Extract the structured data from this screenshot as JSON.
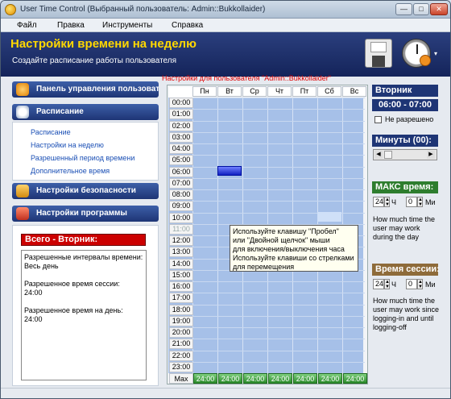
{
  "window": {
    "title": "User Time Control (Выбранный пользователь: Admin::Bukkollaider)"
  },
  "menu": [
    "Файл",
    "Правка",
    "Инструменты",
    "Справка"
  ],
  "header": {
    "title": "Настройки времени на неделю",
    "subtitle": "Создайте расписание работы пользователя"
  },
  "sidebar": {
    "users_panel": "Панель управления пользователями",
    "schedule_panel": "Расписание",
    "schedule_links": [
      "Расписание",
      "Настройки на неделю",
      "Разрешенный период времени",
      "Дополнительное время"
    ],
    "security_panel": "Настройки безопасности",
    "program_panel": "Настройки программы"
  },
  "summary": {
    "title": "Всего - Вторник:",
    "lines": [
      "Разрешенные интервалы времени:",
      "Весь день",
      "",
      "Разрешенное время сессии:",
      "24:00",
      "",
      "Разрешенное время на день:",
      "24:00"
    ]
  },
  "grid": {
    "caption": "Настройки для пользователя \"Admin::Bukkollaider\"",
    "days": [
      "Пн",
      "Вт",
      "Ср",
      "Чт",
      "Пт",
      "Сб",
      "Вс"
    ],
    "hours": [
      "00:00",
      "01:00",
      "02:00",
      "03:00",
      "04:00",
      "05:00",
      "06:00",
      "07:00",
      "08:00",
      "09:00",
      "10:00",
      "11:00",
      "12:00",
      "13:00",
      "14:00",
      "15:00",
      "16:00",
      "17:00",
      "18:00",
      "19:00",
      "20:00",
      "21:00",
      "22:00",
      "23:00"
    ],
    "max_label": "Max",
    "max_values": [
      "24:00",
      "24:00",
      "24:00",
      "24:00",
      "24:00",
      "24:00",
      "24:00"
    ],
    "tooltip": [
      "Используйте клавишу \"Пробел\"",
      "или \"Двойной щелчок\" мыши",
      "для включения/выключения часа",
      "Используйте клавиши со стрелками",
      "для перемещения"
    ]
  },
  "right": {
    "day": "Вторник",
    "time_range": "06:00 - 07:00",
    "not_allowed": "Не разрешено",
    "minutes_label": "Минуты (00):",
    "max_time_label": "МАКС время:",
    "max_hours": "24",
    "max_minutes": "0",
    "hours_unit": "Ч",
    "minutes_unit": "Ми",
    "max_desc": [
      "How much time the",
      "user may work",
      "during the day"
    ],
    "session_label": "Время сессии:",
    "session_hours": "24",
    "session_minutes": "0",
    "session_desc": [
      "How much time the",
      "user may work since",
      "logging-in and until",
      "logging-off"
    ]
  },
  "colors": {
    "header_bg": "#1e3575",
    "header_title": "#ffd800",
    "grid_cell": "#a6c0e8",
    "selected": "#1020c0",
    "max_green": "#2a8a2a",
    "alert_red": "#cc0000"
  }
}
